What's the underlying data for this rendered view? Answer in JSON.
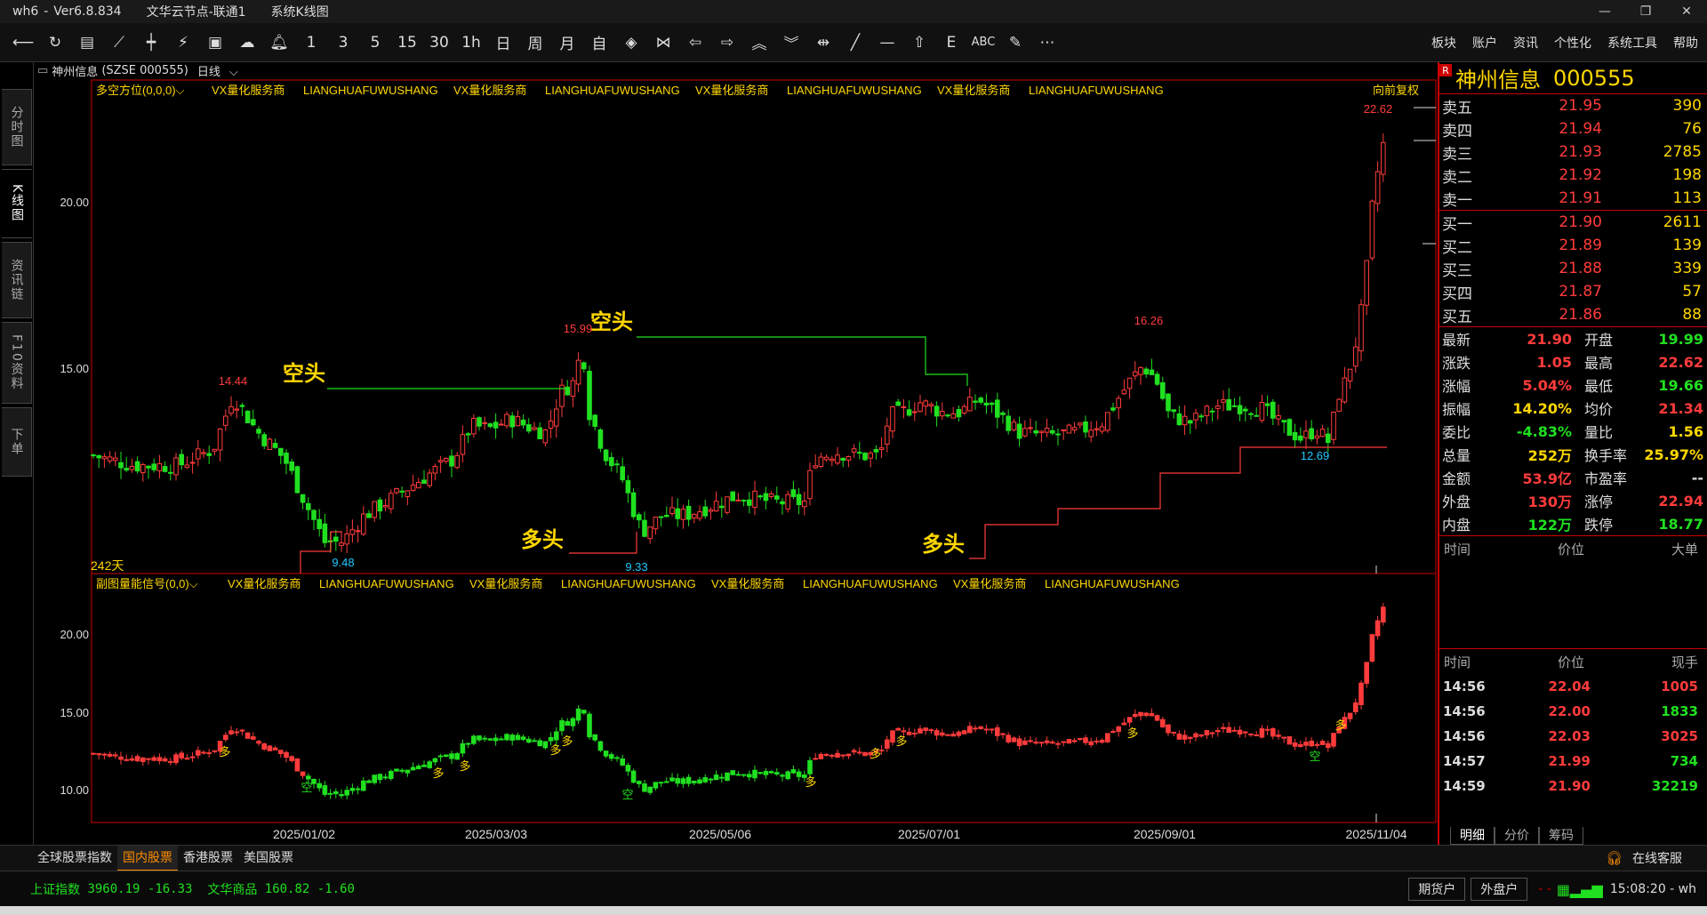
{
  "window": {
    "app": "wh6",
    "version": "Ver6.8.834",
    "server": "文华云节点-联通1",
    "menu": "系统K线图",
    "controls": [
      "—",
      "❐",
      "✕"
    ]
  },
  "toolbar": {
    "icons": [
      "back-icon",
      "refresh-icon",
      "list-icon",
      "line-chart-icon",
      "candle-icon",
      "indicator-icon",
      "quote-board-icon",
      "cloud-icon",
      "bell-icon"
    ],
    "periods": [
      "1",
      "3",
      "5",
      "15",
      "30",
      "1h",
      "日",
      "周",
      "月",
      "自"
    ],
    "right_menu": [
      "板块",
      "账户",
      "资讯",
      "个性化",
      "系统工具",
      "帮助"
    ]
  },
  "left_tabs": [
    "分时图",
    "K线图",
    "资讯链",
    "F10资料",
    "下单"
  ],
  "chart": {
    "header_name": "神州信息",
    "header_code": "(SZSE 000555)",
    "period": "日线",
    "main_indicator": "多空方位(0,0,0)",
    "sub_indicator": "副图量能信号(0,0)",
    "ad_a": "VX量化服务商",
    "ad_b": "LIANGHUAFUWUSHANG",
    "adjust": "向前复权",
    "days": "242天",
    "main_price_labels": [
      "20.00",
      "15.00"
    ],
    "sub_price_labels": [
      "20.00",
      "15.00",
      "10.00"
    ],
    "dates": [
      "2025/01/02",
      "2025/03/03",
      "2025/05/06",
      "2025/07/01",
      "2025/09/01",
      "2025/11/04"
    ],
    "annotations": {
      "high1": "14.44",
      "high2": "15.99",
      "high3": "16.26",
      "high4": "22.62",
      "low1": "9.48",
      "low2": "9.33",
      "low3": "12.69",
      "bear": "空头",
      "bull": "多头",
      "sig_bull": "多",
      "sig_bear": "空"
    }
  },
  "quote": {
    "badge": "R",
    "name": "神州信息",
    "code": "000555",
    "asks": [
      {
        "label": "卖五",
        "price": "21.95",
        "vol": "390"
      },
      {
        "label": "卖四",
        "price": "21.94",
        "vol": "76"
      },
      {
        "label": "卖三",
        "price": "21.93",
        "vol": "2785"
      },
      {
        "label": "卖二",
        "price": "21.92",
        "vol": "198"
      },
      {
        "label": "卖一",
        "price": "21.91",
        "vol": "113"
      }
    ],
    "bids": [
      {
        "label": "买一",
        "price": "21.90",
        "vol": "2611"
      },
      {
        "label": "买二",
        "price": "21.89",
        "vol": "139"
      },
      {
        "label": "买三",
        "price": "21.88",
        "vol": "339"
      },
      {
        "label": "买四",
        "price": "21.87",
        "vol": "57"
      },
      {
        "label": "买五",
        "price": "21.86",
        "vol": "88"
      }
    ],
    "stats": [
      {
        "l1": "最新",
        "v1": "21.90",
        "c1": "red",
        "l2": "开盘",
        "v2": "19.99",
        "c2": "green"
      },
      {
        "l1": "涨跌",
        "v1": "1.05",
        "c1": "red",
        "l2": "最高",
        "v2": "22.62",
        "c2": "red"
      },
      {
        "l1": "涨幅",
        "v1": "5.04%",
        "c1": "red",
        "l2": "最低",
        "v2": "19.66",
        "c2": "green"
      },
      {
        "l1": "振幅",
        "v1": "14.20%",
        "c1": "yellow",
        "l2": "均价",
        "v2": "21.34",
        "c2": "red"
      },
      {
        "l1": "委比",
        "v1": "-4.83%",
        "c1": "green",
        "l2": "量比",
        "v2": "1.56",
        "c2": "yellow"
      },
      {
        "l1": "总量",
        "v1": "252万",
        "c1": "yellow",
        "l2": "换手率",
        "v2": "25.97%",
        "c2": "yellow"
      },
      {
        "l1": "金额",
        "v1": "53.9亿",
        "c1": "red",
        "l2": "市盈率",
        "v2": "--",
        "c2": "white"
      },
      {
        "l1": "外盘",
        "v1": "130万",
        "c1": "red",
        "l2": "涨停",
        "v2": "22.94",
        "c2": "red"
      },
      {
        "l1": "内盘",
        "v1": "122万",
        "c1": "green",
        "l2": "跌停",
        "v2": "18.77",
        "c2": "green"
      }
    ],
    "sect1": {
      "c1": "时间",
      "c2": "价位",
      "c3": "大单"
    },
    "sect2": {
      "c1": "时间",
      "c2": "价位",
      "c3": "现手"
    },
    "ticks": [
      {
        "time": "14:56",
        "price": "22.04",
        "vol": "1005",
        "c": "red"
      },
      {
        "time": "14:56",
        "price": "22.00",
        "vol": "1833",
        "c": "green"
      },
      {
        "time": "14:56",
        "price": "22.03",
        "vol": "3025",
        "c": "red"
      },
      {
        "time": "14:57",
        "price": "21.99",
        "vol": "734",
        "c": "green"
      },
      {
        "time": "14:59",
        "price": "21.90",
        "vol": "32219",
        "c": "green"
      }
    ],
    "tabs": [
      "明细",
      "分价",
      "筹码"
    ]
  },
  "bottom_tabs": [
    "全球股票指数",
    "国内股票",
    "香港股票",
    "美国股票"
  ],
  "service": "在线客服",
  "status": {
    "idx1_name": "上证指数",
    "idx1_val": "3960.19",
    "idx1_chg": "-16.33",
    "idx2_name": "文华商品",
    "idx2_val": "160.82",
    "idx2_chg": "-1.60",
    "btn1": "期货户",
    "btn2": "外盘户",
    "dash": "- -",
    "clock": "15:08:20 - wh"
  },
  "colors": {
    "up": "#ff3b3b",
    "down": "#20e020",
    "accent": "#ffd700",
    "frame": "#cc0000"
  }
}
